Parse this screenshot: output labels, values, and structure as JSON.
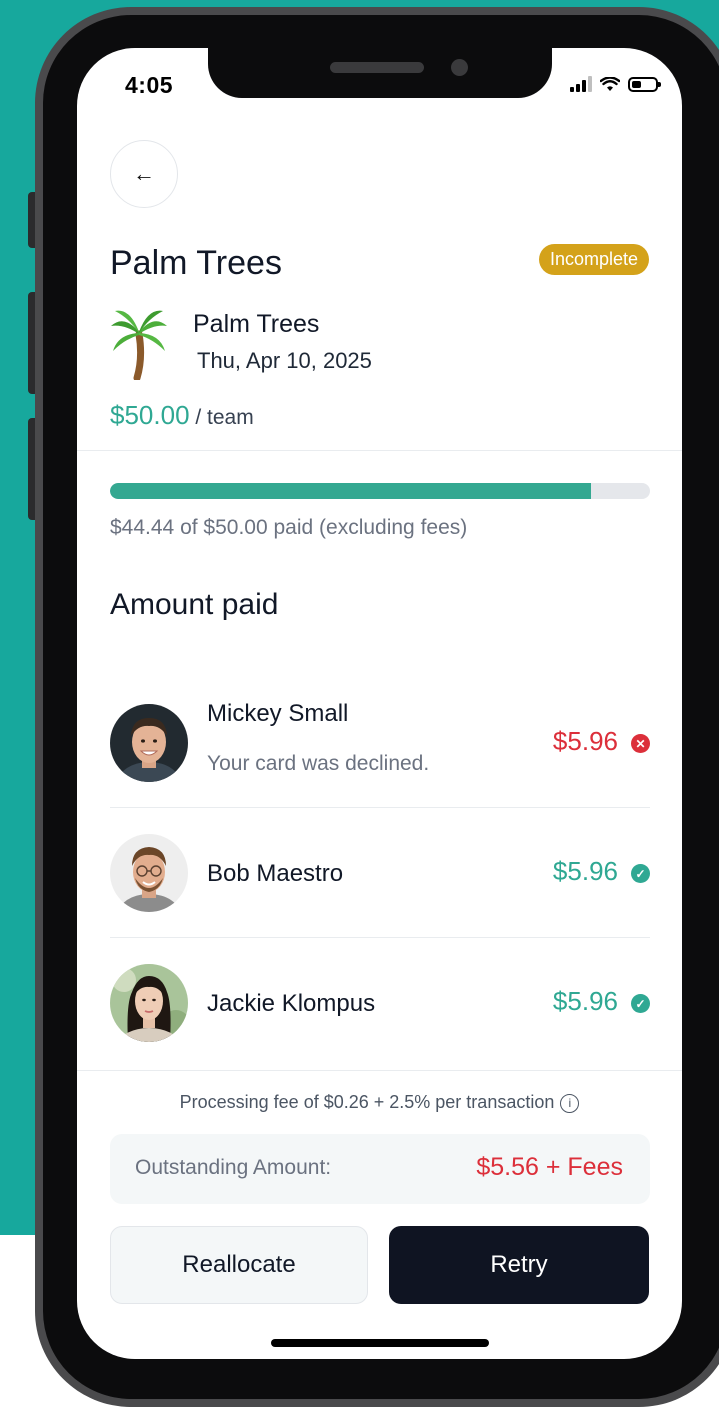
{
  "status_bar": {
    "time": "4:05"
  },
  "header": {
    "title": "Palm Trees",
    "badge": "Incomplete",
    "badge_color": "#d4a21a"
  },
  "event": {
    "name": "Palm Trees",
    "date": "Thu, Apr 10, 2025",
    "price": "$50.00",
    "price_suffix": "/ team"
  },
  "progress": {
    "fraction": 0.89,
    "text": "$44.44 of $50.00 paid (excluding fees)"
  },
  "section_title": "Amount paid",
  "payers": [
    {
      "name": "Mickey Small",
      "note": "Your card was declined.",
      "amount": "$5.96",
      "status": "declined"
    },
    {
      "name": "Bob Maestro",
      "note": "",
      "amount": "$5.96",
      "status": "paid"
    },
    {
      "name": "Jackie Klompus",
      "note": "",
      "amount": "$5.96",
      "status": "paid"
    }
  ],
  "fee_text": "Processing fee of $0.26 + 2.5% per transaction",
  "outstanding": {
    "label": "Outstanding Amount:",
    "value": "$5.56 + Fees"
  },
  "buttons": {
    "reallocate": "Reallocate",
    "retry": "Retry"
  },
  "colors": {
    "accent": "#2fa893",
    "error": "#dc2f3a",
    "dark": "#0f1422",
    "background": "#17a89d"
  }
}
